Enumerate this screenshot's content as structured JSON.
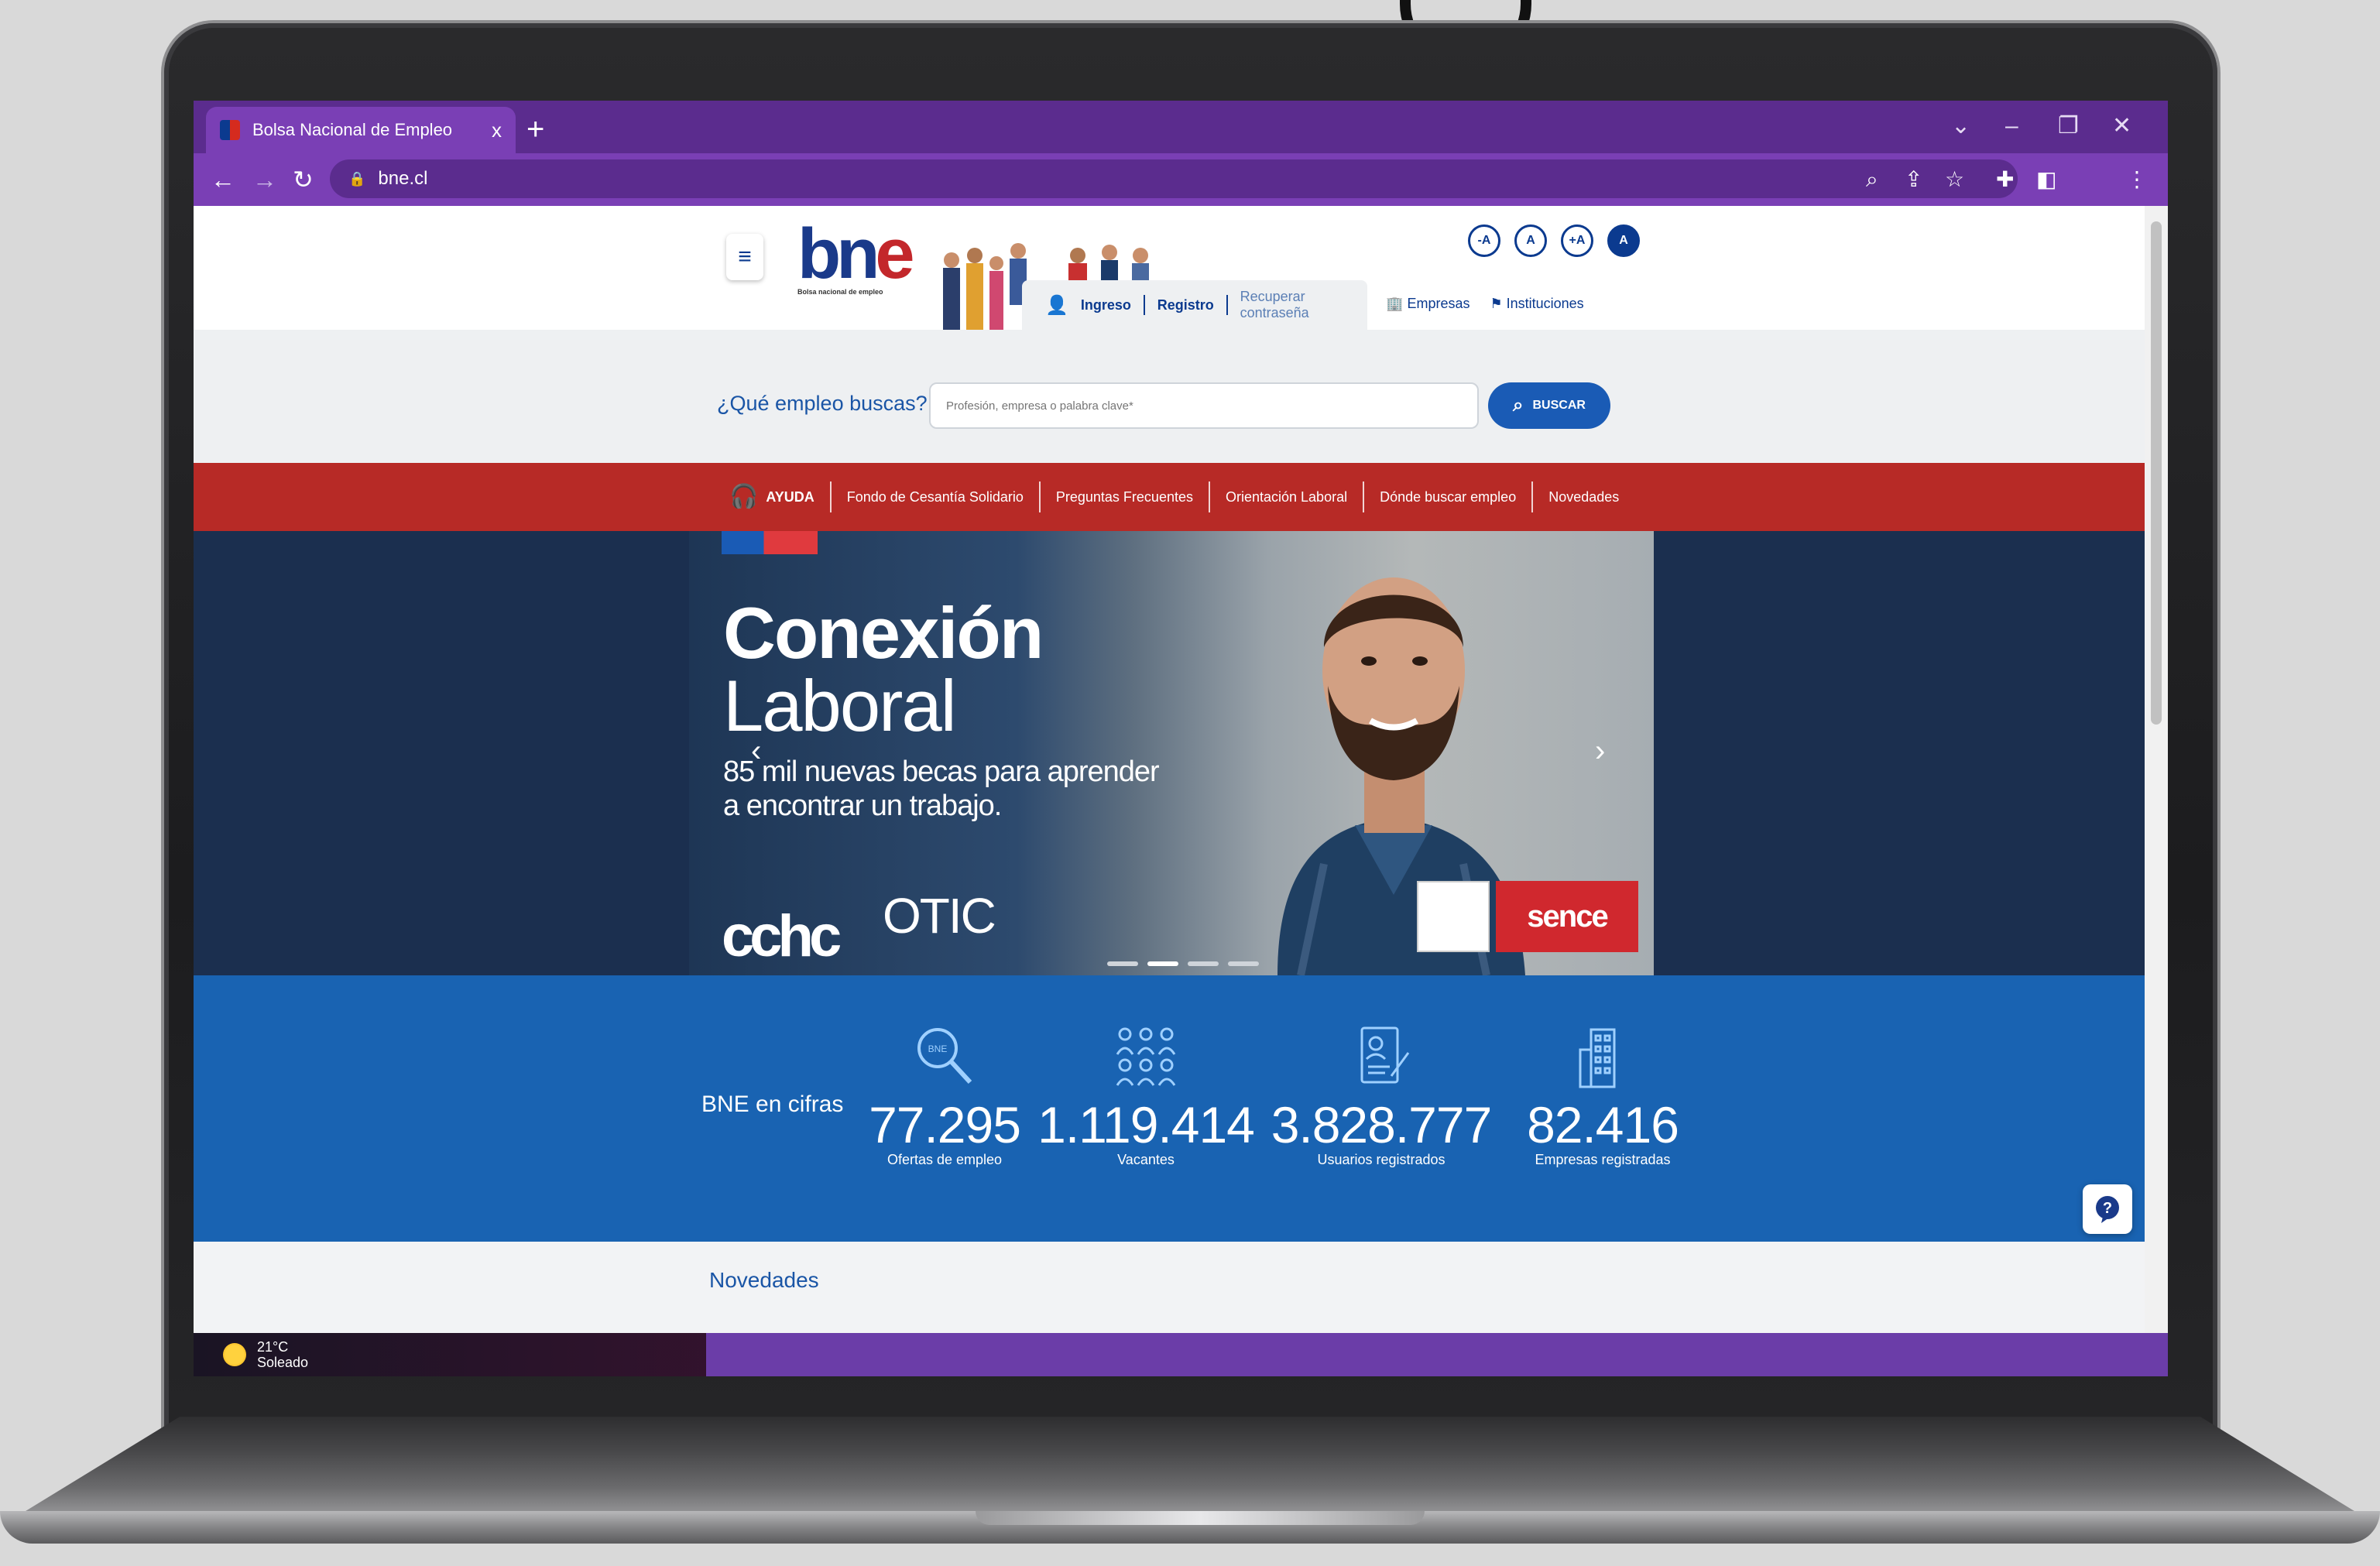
{
  "browser": {
    "tab_title": "Bolsa Nacional de Empleo",
    "tab_close": "x",
    "new_tab": "+",
    "url": "bne.cl",
    "win_minimize": "–",
    "win_maximize": "❐",
    "win_close": "✕",
    "win_dropdown": "⌄"
  },
  "header": {
    "logo_main": "bn",
    "logo_accent": "e",
    "logo_subtitle": "Bolsa nacional de empleo",
    "a11y": [
      "-A",
      "A",
      "+A",
      "A"
    ],
    "login": {
      "ingreso": "Ingreso",
      "registro": "Registro",
      "recuperar": "Recuperar contraseña"
    },
    "links": {
      "empresas": "Empresas",
      "instituciones": "Instituciones"
    }
  },
  "search": {
    "label": "¿Qué empleo buscas?",
    "placeholder": "Profesión, empresa o palabra clave*",
    "button": "BUSCAR"
  },
  "nav": {
    "ayuda": "AYUDA",
    "items": [
      "Fondo de Cesantía Solidario",
      "Preguntas Frecuentes",
      "Orientación Laboral",
      "Dónde buscar empleo",
      "Novedades"
    ]
  },
  "hero": {
    "title_line1": "Conexión",
    "title_line2": "Laboral",
    "subtitle_line1": "85 mil nuevas becas para aprender",
    "subtitle_line2": "a encontrar un trabajo.",
    "logo_cchc": "cchc",
    "logo_otic": "OTIC",
    "logo_sence": "sence"
  },
  "stats": {
    "title": "BNE en cifras",
    "items": [
      {
        "value": "77.295",
        "label": "Ofertas de empleo",
        "icon": "search-magnifier-icon"
      },
      {
        "value": "1.119.414",
        "label": "Vacantes",
        "icon": "people-group-icon"
      },
      {
        "value": "3.828.777",
        "label": "Usuarios registrados",
        "icon": "user-document-icon"
      },
      {
        "value": "82.416",
        "label": "Empresas registradas",
        "icon": "building-icon"
      }
    ]
  },
  "novedades": {
    "title": "Novedades"
  },
  "taskbar": {
    "temperature": "21°C",
    "condition": "Soleado"
  },
  "colors": {
    "chrome_purple": "#5b2c8e",
    "toolbar_purple": "#7a3fb5",
    "nav_red": "#b72a26",
    "stats_blue": "#1963b2",
    "hero_navy": "#1b2f4f",
    "brand_blue": "#0b3a8f"
  }
}
